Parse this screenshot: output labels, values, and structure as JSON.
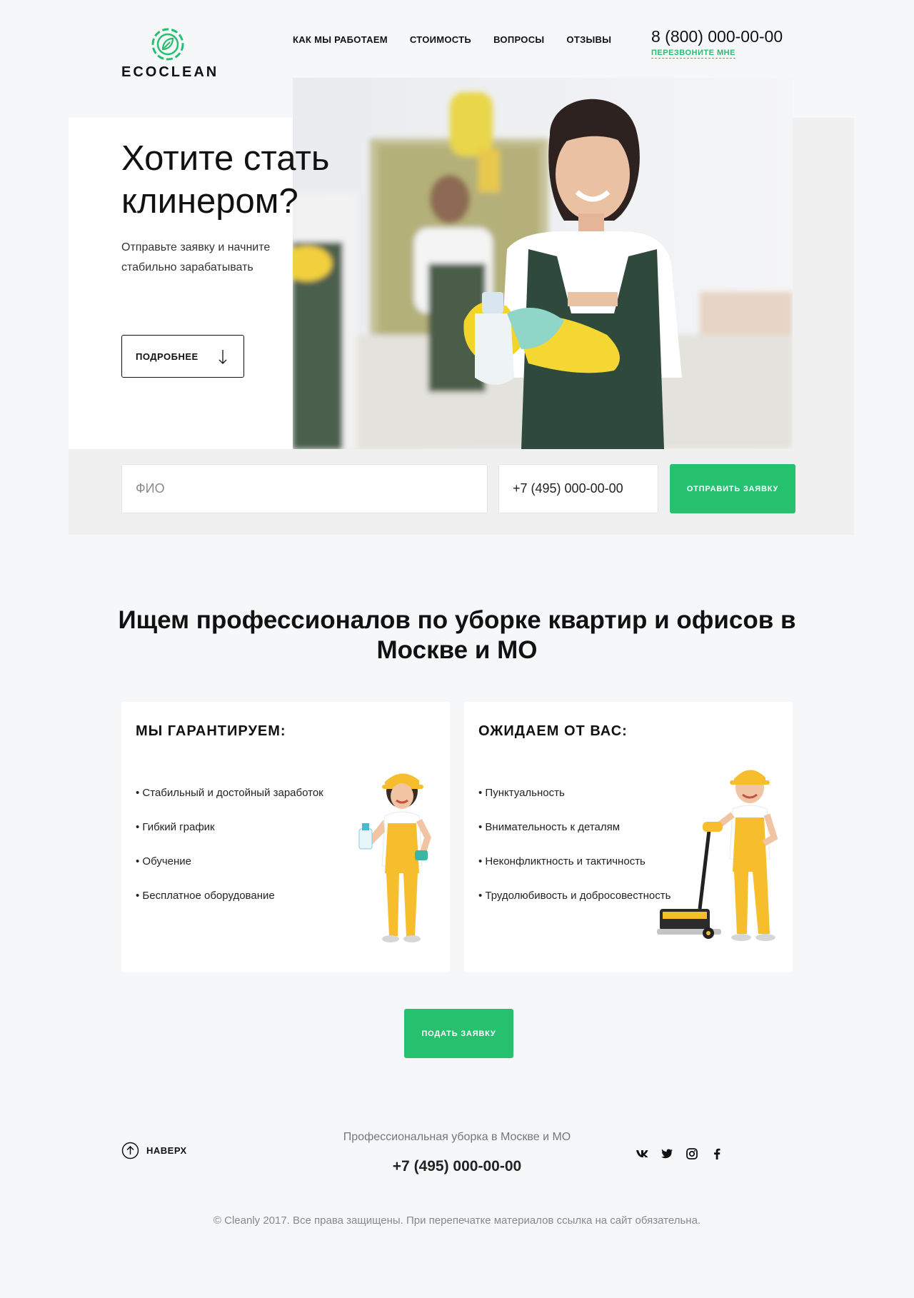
{
  "header": {
    "logo_text": "ECOCLEAN",
    "nav": [
      "КАК МЫ РАБОТАЕМ",
      "СТОИМОСТЬ",
      "ВОПРОСЫ",
      "ОТЗЫВЫ"
    ],
    "phone": "8 (800) 000-00-00",
    "callback_label": "ПЕРЕЗВОНИТЕ МНЕ"
  },
  "hero": {
    "title": "Хотите стать клинером?",
    "subtitle": "Отправьте заявку и начните стабильно зарабатывать",
    "more_label": "ПОДРОБНЕЕ"
  },
  "form": {
    "name_placeholder": "ФИО",
    "phone_value": "+7 (495) 000-00-00",
    "submit_label": "ОТПРАВИТЬ ЗАЯВКУ"
  },
  "section": {
    "title": "Ищем профессионалов по уборке квартир и офисов в Москве и МО",
    "guarantee": {
      "title": "МЫ ГАРАНТИРУЕМ:",
      "items": [
        "Стабильный и достойный заработок",
        "Гибкий график",
        "Обучение",
        "Бесплатное оборудование"
      ]
    },
    "expect": {
      "title": "ОЖИДАЕМ ОТ ВАС:",
      "items": [
        "Пунктуальность",
        "Внимательность к деталям",
        "Неконфликтность и тактичность",
        "Трудолюбивость и добросовестность"
      ]
    },
    "apply_label": "ПОДАТЬ ЗАЯВКУ"
  },
  "footer": {
    "to_top_label": "НАВЕРХ",
    "tagline": "Профессиональная уборка в Москве и МО",
    "phone": "+7 (495) 000-00-00",
    "social_icons": [
      "vk-icon",
      "twitter-icon",
      "instagram-icon",
      "facebook-icon"
    ],
    "copyright": "© Cleanly 2017. Все права защищены. При перепечатке материалов ссылка на сайт обязательна."
  },
  "colors": {
    "accent": "#25c16f",
    "background": "#f5f7f9",
    "text": "#111111"
  }
}
